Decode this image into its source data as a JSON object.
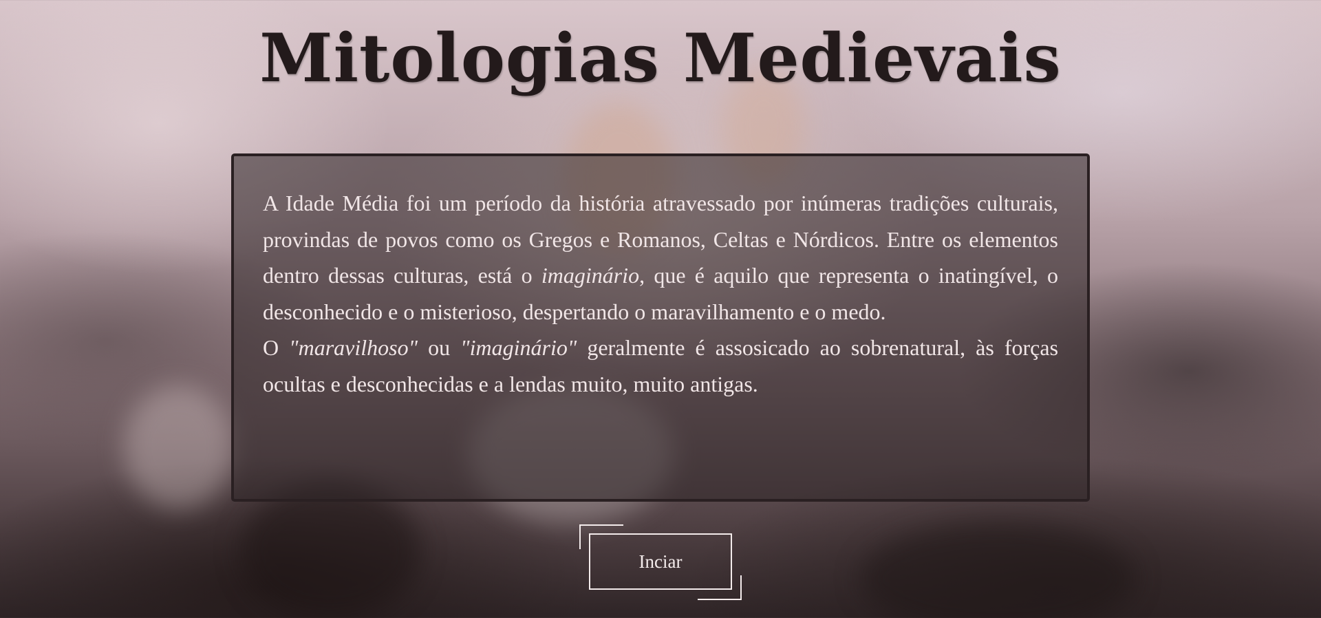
{
  "page": {
    "title": "Mitologias Medievais"
  },
  "intro": {
    "p1_before": "A Idade Média foi um período da história atravessado por inúmeras tradições culturais, provindas de povos como os Gregos e Romanos, Celtas e Nórdicos. Entre os elementos dentro dessas culturas, está o ",
    "p1_em": "imaginário",
    "p1_after": ", que é aquilo que representa o inatingível, o desconhecido e o misterioso, despertando o maravilhamento e o medo.",
    "p2_start": "O ",
    "p2_em1": "\"maravilhoso\"",
    "p2_mid": " ou ",
    "p2_em2": "\"imaginário\"",
    "p2_end": " geralmente é assosicado ao sobrenatural, às forças ocultas e desconhecidas e a lendas muito, muito antigas."
  },
  "start_button": {
    "label": "Inciar"
  },
  "colors": {
    "title": "#231a1b",
    "box_border": "#2a2022",
    "text": "#f1e6e7",
    "button": "#f4ecec"
  }
}
